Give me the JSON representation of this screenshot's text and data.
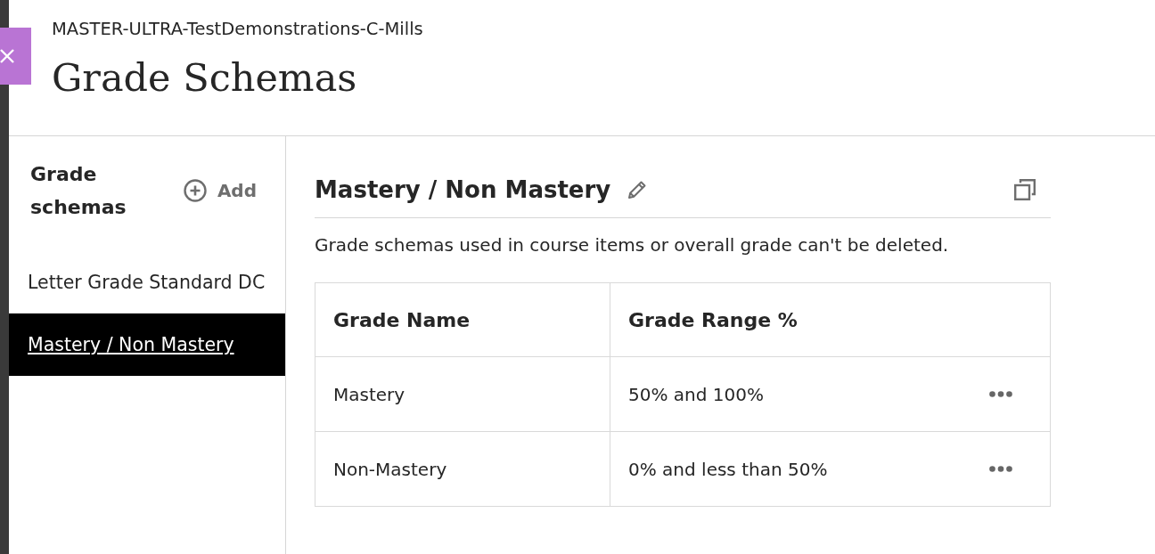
{
  "header": {
    "course": "MASTER-ULTRA-TestDemonstrations-C-Mills",
    "title": "Grade Schemas"
  },
  "sidebar": {
    "title": "Grade schemas",
    "add_label": "Add",
    "items": [
      {
        "label": "Letter Grade Standard DC",
        "selected": false
      },
      {
        "label": "Mastery / Non Mastery",
        "selected": true
      }
    ]
  },
  "detail": {
    "title": "Mastery / Non Mastery",
    "notice": "Grade schemas used in course items or overall grade can't be deleted.",
    "table": {
      "columns": [
        "Grade Name",
        "Grade Range %"
      ],
      "rows": [
        {
          "name": "Mastery",
          "range": "50% and 100%"
        },
        {
          "name": "Non-Mastery",
          "range": "0% and less than 50%"
        }
      ]
    }
  }
}
